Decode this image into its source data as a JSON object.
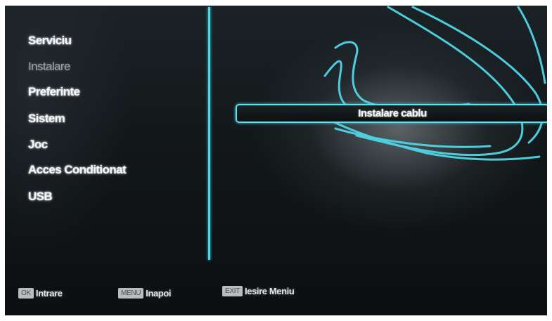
{
  "menu": {
    "items": [
      {
        "label": "Serviciu"
      },
      {
        "label": "Instalare"
      },
      {
        "label": "Preferinte"
      },
      {
        "label": "Sistem"
      },
      {
        "label": "Joc"
      },
      {
        "label": "Acces Conditionat"
      },
      {
        "label": "USB"
      }
    ],
    "selected": "Instalare"
  },
  "submenu": {
    "option_label": "Instalare cablu"
  },
  "footer": {
    "hints": [
      {
        "key": "OK",
        "label": "Intrare"
      },
      {
        "key": "MENU",
        "label": "Inapoi"
      },
      {
        "key": "EXIT",
        "label": "Iesire Meniu"
      }
    ]
  },
  "colors": {
    "accent": "#5ee0ee",
    "background": "#0f1316",
    "text": "#f2f6f8",
    "key_bg": "#b9bdbf"
  }
}
